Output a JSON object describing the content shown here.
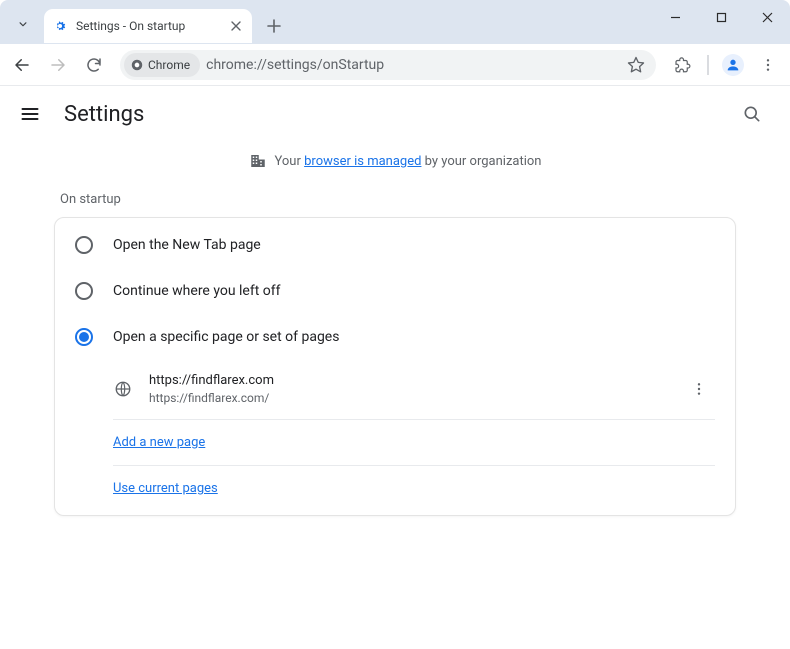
{
  "window": {
    "tab_title": "Settings - On startup"
  },
  "toolbar": {
    "omnibox_chip": "Chrome",
    "url": "chrome://settings/onStartup"
  },
  "settings": {
    "title": "Settings",
    "managed_prefix": "Your ",
    "managed_link": "browser is managed",
    "managed_suffix": " by your organization",
    "section_label": "On startup",
    "options": {
      "new_tab": "Open the New Tab page",
      "continue": "Continue where you left off",
      "specific": "Open a specific page or set of pages"
    },
    "pages": [
      {
        "title": "https://findflarex.com",
        "url": "https://findflarex.com/"
      }
    ],
    "add_page": "Add a new page",
    "use_current": "Use current pages"
  }
}
